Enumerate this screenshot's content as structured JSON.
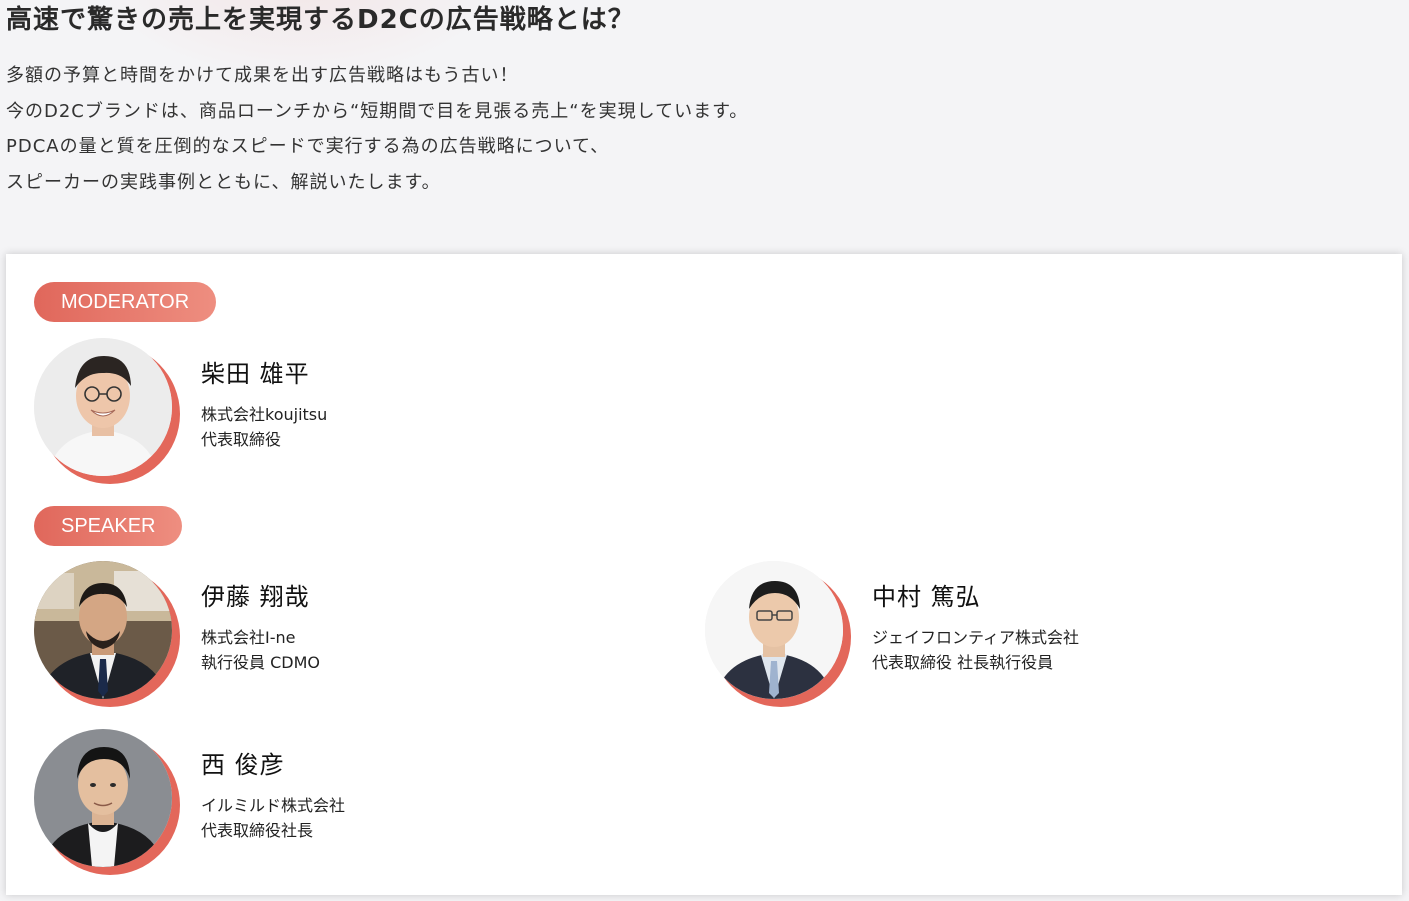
{
  "headline": "高速で驚きの売上を実現するD2Cの広告戦略とは？",
  "intro": [
    "多額の予算と時間をかけて成果を出す広告戦略はもう古い！",
    "今のD2Cブランドは、商品ローンチから“短期間で目を見張る売上“を実現しています。",
    "PDCAの量と質を圧倒的なスピードで実行する為の広告戦略について、",
    "スピーカーの実践事例とともに、解説いたします。"
  ],
  "colors": {
    "accent": "#e3675a",
    "accent_light": "#ee8e80",
    "page_bg": "#f4f4f6",
    "card_bg": "#ffffff"
  },
  "moderator": {
    "role_label": "MODERATOR",
    "person": {
      "name": "柴田 雄平",
      "company": "株式会社koujitsu",
      "title": "代表取締役"
    }
  },
  "speakers": {
    "role_label": "SPEAKER",
    "people": [
      {
        "name": "伊藤 翔哉",
        "company": "株式会社I-ne",
        "title": "執行役員 CDMO"
      },
      {
        "name": "中村 篤弘",
        "company": "ジェイフロンティア株式会社",
        "title": "代表取締役 社長執行役員"
      },
      {
        "name": "西 俊彦",
        "company": "イルミルド株式会社",
        "title": "代表取締役社長"
      }
    ]
  }
}
